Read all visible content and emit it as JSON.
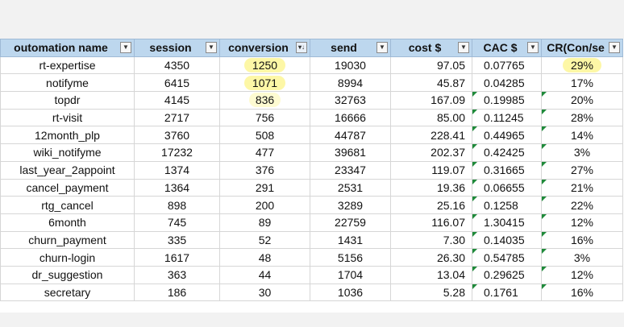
{
  "headers": [
    "outomation name",
    "session",
    "conversion",
    "send",
    "cost $",
    "CAC $",
    "CR(Con/se"
  ],
  "highlight_color": "#fdf7a6",
  "header_color": "#bdd7ee",
  "rows": [
    {
      "name": "rt-expertise",
      "session": "4350",
      "conversion": "1250",
      "send": "19030",
      "cost": "97.05",
      "cac": "0.07765",
      "cr": "29%"
    },
    {
      "name": "notifyme",
      "session": "6415",
      "conversion": "1071",
      "send": "8994",
      "cost": "45.87",
      "cac": "0.04285",
      "cr": "17%"
    },
    {
      "name": "topdr",
      "session": "4145",
      "conversion": "836",
      "send": "32763",
      "cost": "167.09",
      "cac": "0.19985",
      "cr": "20%"
    },
    {
      "name": "rt-visit",
      "session": "2717",
      "conversion": "756",
      "send": "16666",
      "cost": "85.00",
      "cac": "0.11245",
      "cr": "28%"
    },
    {
      "name": "12month_plp",
      "session": "3760",
      "conversion": "508",
      "send": "44787",
      "cost": "228.41",
      "cac": "0.44965",
      "cr": "14%"
    },
    {
      "name": "wiki_notifyme",
      "session": "17232",
      "conversion": "477",
      "send": "39681",
      "cost": "202.37",
      "cac": "0.42425",
      "cr": "3%"
    },
    {
      "name": "last_year_2appoint",
      "session": "1374",
      "conversion": "376",
      "send": "23347",
      "cost": "119.07",
      "cac": "0.31665",
      "cr": "27%"
    },
    {
      "name": "cancel_payment",
      "session": "1364",
      "conversion": "291",
      "send": "2531",
      "cost": "19.36",
      "cac": "0.06655",
      "cr": "21%"
    },
    {
      "name": "rtg_cancel",
      "session": "898",
      "conversion": "200",
      "send": "3289",
      "cost": "25.16",
      "cac": "0.1258",
      "cr": "22%"
    },
    {
      "name": "6month",
      "session": "745",
      "conversion": "89",
      "send": "22759",
      "cost": "116.07",
      "cac": "1.30415",
      "cr": "12%"
    },
    {
      "name": "churn_payment",
      "session": "335",
      "conversion": "52",
      "send": "1431",
      "cost": "7.30",
      "cac": "0.14035",
      "cr": "16%"
    },
    {
      "name": "churn-login",
      "session": "1617",
      "conversion": "48",
      "send": "5156",
      "cost": "26.30",
      "cac": "0.54785",
      "cr": "3%"
    },
    {
      "name": "dr_suggestion",
      "session": "363",
      "conversion": "44",
      "send": "1704",
      "cost": "13.04",
      "cac": "0.29625",
      "cr": "12%"
    },
    {
      "name": "secretary",
      "session": "186",
      "conversion": "30",
      "send": "1036",
      "cost": "5.28",
      "cac": "0.1761",
      "cr": "16%"
    }
  ]
}
